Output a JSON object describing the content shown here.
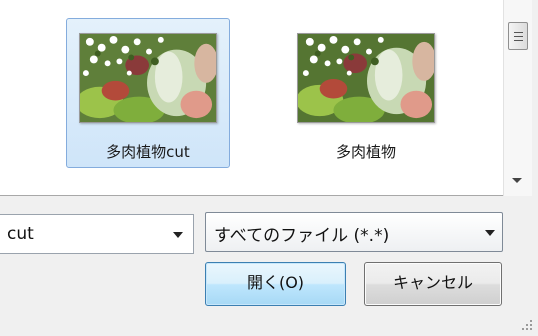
{
  "files": [
    {
      "name": "多肉植物cut",
      "selected": true,
      "thumbnail": "succulent-photo"
    },
    {
      "name": "多肉植物",
      "selected": false,
      "thumbnail": "succulent-photo"
    }
  ],
  "filename_field": {
    "value": "cut"
  },
  "file_type_filter": {
    "selected": "すべてのファイル (*.*)"
  },
  "buttons": {
    "open_label": "開く(O)",
    "cancel_label": "キャンセル"
  },
  "colors": {
    "selection_bg": "#cfe5f9",
    "selection_border": "#84acdd",
    "open_button_border": "#3c7fb1",
    "dialog_bg": "#f0f0f0"
  }
}
